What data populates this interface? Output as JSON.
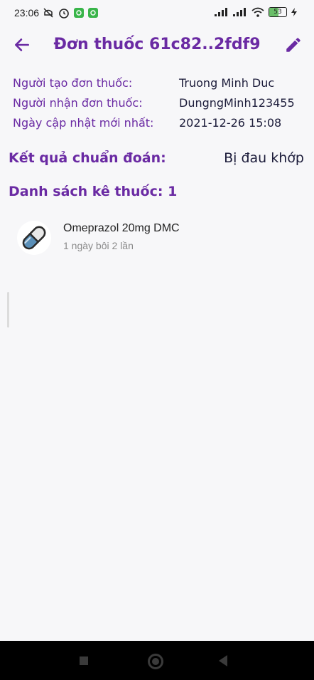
{
  "status_bar": {
    "time": "23:06",
    "battery": "53"
  },
  "app_bar": {
    "title": "Đơn thuốc 61c82..2fdf9"
  },
  "info": [
    {
      "label": "Người tạo đơn thuốc:",
      "value": "Truong Minh Duc"
    },
    {
      "label": "Người nhận đơn thuốc:",
      "value": "DungngMinh123455"
    },
    {
      "label": "Ngày cập nhật mới nhất:",
      "value": "2021-12-26 15:08"
    }
  ],
  "diagnosis": {
    "label": "Kết quả chuẩn đoán:",
    "value": "Bị đau khớp"
  },
  "medicine_list": {
    "title": "Danh sách kê thuốc: 1",
    "items": [
      {
        "name": "Omeprazol 20mg DMC",
        "dosage": "1 ngày bôi 2 lần"
      }
    ]
  },
  "colors": {
    "primary": "#6a2aa3",
    "value_text": "#1c1c3a",
    "background": "#f7f7f9"
  }
}
